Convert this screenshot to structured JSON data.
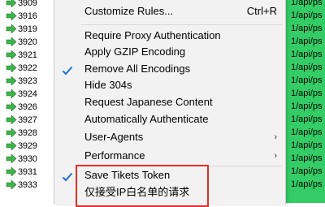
{
  "sessions": [
    {
      "id": "3909"
    },
    {
      "id": "3916"
    },
    {
      "id": "3919"
    },
    {
      "id": "3920"
    },
    {
      "id": "3921"
    },
    {
      "id": "3922"
    },
    {
      "id": "3923"
    },
    {
      "id": "3924"
    },
    {
      "id": "3926"
    },
    {
      "id": "3927"
    },
    {
      "id": "3928"
    },
    {
      "id": "3929"
    },
    {
      "id": "3930"
    },
    {
      "id": "3931"
    },
    {
      "id": "3933"
    }
  ],
  "url_cells": [
    "1/api/ps",
    "1/api/ps",
    "1/api/ps",
    "1/api/ps",
    "1/api/ps",
    "1/api/ps",
    "1/api/ps",
    "1/api/ps",
    "1/api/ps",
    "1/api/ps",
    "1/api/ps",
    "1/api/ps",
    "1/api/ps",
    "1/api/ps",
    "1/api/ps"
  ],
  "menu": {
    "customize": {
      "label": "Customize Rules...",
      "shortcut": "Ctrl+R"
    },
    "items": [
      {
        "label": "Require Proxy Authentication"
      },
      {
        "label": "Apply GZIP Encoding"
      },
      {
        "label": "Remove All Encodings",
        "checked": true
      },
      {
        "label": "Hide 304s"
      },
      {
        "label": "Request Japanese Content"
      },
      {
        "label": "Automatically Authenticate"
      },
      {
        "label": "User-Agents",
        "submenu": true
      },
      {
        "label": "Performance",
        "submenu": true
      },
      {
        "label": "Save Tikets Token",
        "checked": true
      },
      {
        "label": "仅接受IP白名单的请求"
      }
    ],
    "submenu_arrow": "›",
    "check_mark": "✓"
  },
  "colors": {
    "session_green": "#33cc66",
    "menu_bg": "#f2f2f2",
    "check_blue": "#1f6fd0",
    "highlight_red": "#e0302a"
  },
  "icons": {
    "session_row": "green-arrow-icon",
    "checked": "checkmark-icon",
    "submenu": "chevron-right-icon"
  }
}
